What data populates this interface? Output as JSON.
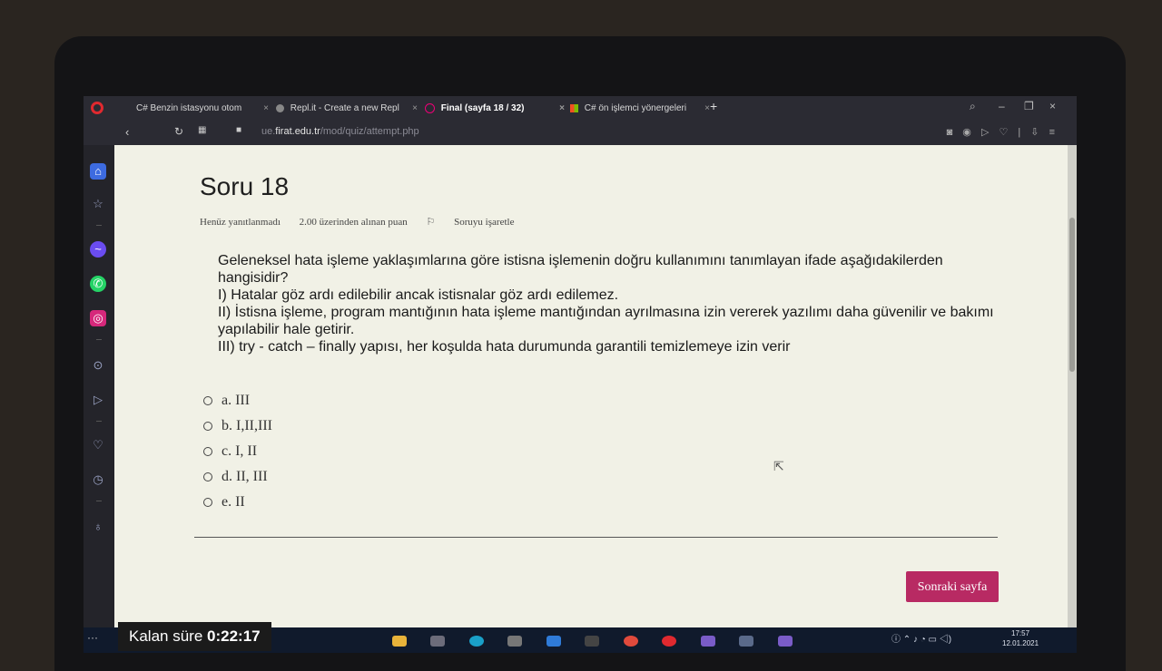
{
  "browser": {
    "tabs": [
      {
        "label": "C# Benzin istasyonu otom"
      },
      {
        "label": "Repl.it - Create a new Repl"
      },
      {
        "label": "Final (sayfa 18 / 32)"
      },
      {
        "label": "C# ön işlemci yönergeleri"
      }
    ],
    "url_prefix": "ue.",
    "url_domain": "firat.edu.tr",
    "url_path": "/mod/quiz/attempt.php"
  },
  "question": {
    "title": "Soru 18",
    "status": "Henüz yanıtlanmadı",
    "points": "2.00 üzerinden alınan puan",
    "flag_label": "Soruyu işaretle",
    "text_lines": [
      "Geleneksel hata işleme yaklaşımlarına göre istisna işlemenin doğru kullanımını tanımlayan ifade aşağıdakilerden hangisidir?",
      "I) Hatalar göz ardı edilebilir ancak istisnalar göz ardı edilemez.",
      "II) İstisna işleme, program mantığının hata işleme mantığından ayrılmasına izin vererek yazılımı daha güvenilir ve bakımı yapılabilir hale getirir.",
      "III) try - catch – finally yapısı, her koşulda hata durumunda garantili temizlemeye izin verir"
    ],
    "answers": [
      {
        "label": "a. III"
      },
      {
        "label": "b. I,II,III"
      },
      {
        "label": "c. I, II"
      },
      {
        "label": "d. II, III"
      },
      {
        "label": "e. II"
      }
    ],
    "next_button": "Sonraki sayfa"
  },
  "timer": {
    "label": "Kalan süre",
    "value": "0:22:17"
  },
  "taskbar": {
    "time": "17:57",
    "date": "12.01.2021"
  },
  "colors": {
    "accent": "#b82a63",
    "page_bg": "#f1f1e6",
    "browser_chrome": "#2b2b33"
  }
}
